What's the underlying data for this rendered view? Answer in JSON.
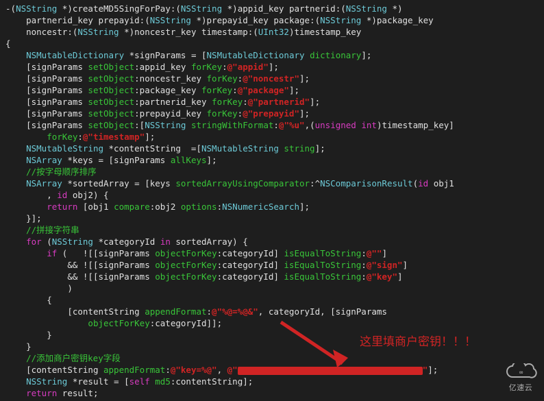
{
  "code": {
    "l1a": "-(",
    "l1b": "NSString",
    "l1c": " *)createMD5SingForPay:(",
    "l1d": "NSString",
    "l1e": " *)appid_key partnerid:(",
    "l1f": "NSString",
    "l1g": " *)",
    "l2a": "partnerid_key prepayid:(",
    "l2b": "NSString",
    "l2c": " *)prepayid_key package:(",
    "l2d": "NSString",
    "l2e": " *)package_key",
    "l3a": "noncestr:(",
    "l3b": "NSString",
    "l3c": " *)noncestr_key timestamp:(",
    "l3d": "UInt32",
    "l3e": ")timestamp_key",
    "l4": "{",
    "l5a": "    ",
    "l5b": "NSMutableDictionary",
    "l5c": " *signParams = [",
    "l5d": "NSMutableDictionary",
    "l5e": " ",
    "l5f": "dictionary",
    "l5g": "];",
    "l6a": "    [signParams ",
    "l6b": "setObject",
    "l6c": ":appid_key ",
    "l6d": "forKey",
    "l6e": ":",
    "l6f": "@\"appid\"",
    "l6g": "];",
    "l7a": "    [signParams ",
    "l7b": "setObject",
    "l7c": ":noncestr_key ",
    "l7d": "forKey",
    "l7e": ":",
    "l7f": "@\"noncestr\"",
    "l7g": "];",
    "l8a": "    [signParams ",
    "l8b": "setObject",
    "l8c": ":package_key ",
    "l8d": "forKey",
    "l8e": ":",
    "l8f": "@\"package\"",
    "l8g": "];",
    "l9a": "    [signParams ",
    "l9b": "setObject",
    "l9c": ":partnerid_key ",
    "l9d": "forKey",
    "l9e": ":",
    "l9f": "@\"partnerid\"",
    "l9g": "];",
    "l10a": "    [signParams ",
    "l10b": "setObject",
    "l10c": ":prepayid_key ",
    "l10d": "forKey",
    "l10e": ":",
    "l10f": "@\"prepayid\"",
    "l10g": "];",
    "l11a": "    [signParams ",
    "l11b": "setObject",
    "l11c": ":[",
    "l11d": "NSString",
    "l11e": " ",
    "l11f": "stringWithFormat",
    "l11g": ":",
    "l11h": "@\"%u\"",
    "l11i": ",(",
    "l11j": "unsigned int",
    "l11k": ")timestamp_key]",
    "l12a": "        ",
    "l12b": "forKey",
    "l12c": ":",
    "l12d": "@\"timestamp\"",
    "l12e": "];",
    "l13a": "    ",
    "l13b": "NSMutableString",
    "l13c": " *contentString  =[",
    "l13d": "NSMutableString",
    "l13e": " ",
    "l13f": "string",
    "l13g": "];",
    "l14a": "    ",
    "l14b": "NSArray",
    "l14c": " *keys = [signParams ",
    "l14d": "allKeys",
    "l14e": "];",
    "l15a": "    ",
    "l15b": "//按字母顺序排序",
    "l16a": "    ",
    "l16b": "NSArray",
    "l16c": " *sortedArray = [keys ",
    "l16d": "sortedArrayUsingComparator",
    "l16e": ":^",
    "l16f": "NSComparisonResult",
    "l16g": "(",
    "l16h": "id",
    "l16i": " obj1",
    "l17a": "        , ",
    "l17b": "id",
    "l17c": " obj2) {",
    "l18a": "        ",
    "l18b": "return",
    "l18c": " [obj1 ",
    "l18d": "compare",
    "l18e": ":obj2 ",
    "l18f": "options",
    "l18g": ":",
    "l18h": "NSNumericSearch",
    "l18i": "];",
    "l19": "    }];",
    "l20a": "    ",
    "l20b": "//拼接字符串",
    "l21a": "    ",
    "l21b": "for",
    "l21c": " (",
    "l21d": "NSString",
    "l21e": " *categoryId ",
    "l21f": "in",
    "l21g": " sortedArray) {",
    "l22a": "        ",
    "l22b": "if",
    "l22c": " (   ![[signParams ",
    "l22d": "objectForKey",
    "l22e": ":categoryId] ",
    "l22f": "isEqualToString",
    "l22g": ":",
    "l22h": "@\"\"",
    "l22i": "]",
    "l23a": "            && ![[signParams ",
    "l23b": "objectForKey",
    "l23c": ":categoryId] ",
    "l23d": "isEqualToString",
    "l23e": ":",
    "l23f": "@\"sign\"",
    "l23g": "]",
    "l24a": "            && ![[signParams ",
    "l24b": "objectForKey",
    "l24c": ":categoryId] ",
    "l24d": "isEqualToString",
    "l24e": ":",
    "l24f": "@\"key\"",
    "l24g": "]",
    "l25": "            )",
    "l26": "        {",
    "l27a": "            [contentString ",
    "l27b": "appendFormat",
    "l27c": ":",
    "l27d": "@\"%@=%@&\"",
    "l27e": ", categoryId, [signParams",
    "l28a": "                ",
    "l28b": "objectForKey",
    "l28c": ":categoryId]];",
    "l29": "        }",
    "l30": "    }",
    "l31a": "    ",
    "l31b": "//添加商户密钥key字段",
    "l32a": "    [contentString ",
    "l32b": "appendFormat",
    "l32c": ":",
    "l32d": "@\"key=%@\"",
    "l32e": ", ",
    "l32f": "@\"",
    "l32h": "\"",
    "l32i": "];",
    "l33a": "    ",
    "l33b": "NSString",
    "l33c": " *result = [",
    "l33d": "self",
    "l33e": " ",
    "l33f": "md5",
    "l33g": ":contentString];",
    "l34a": "    ",
    "l34b": "return",
    "l34c": " result;"
  },
  "annotation_text": "这里填商户密钥！！！",
  "watermark_text": "亿速云"
}
